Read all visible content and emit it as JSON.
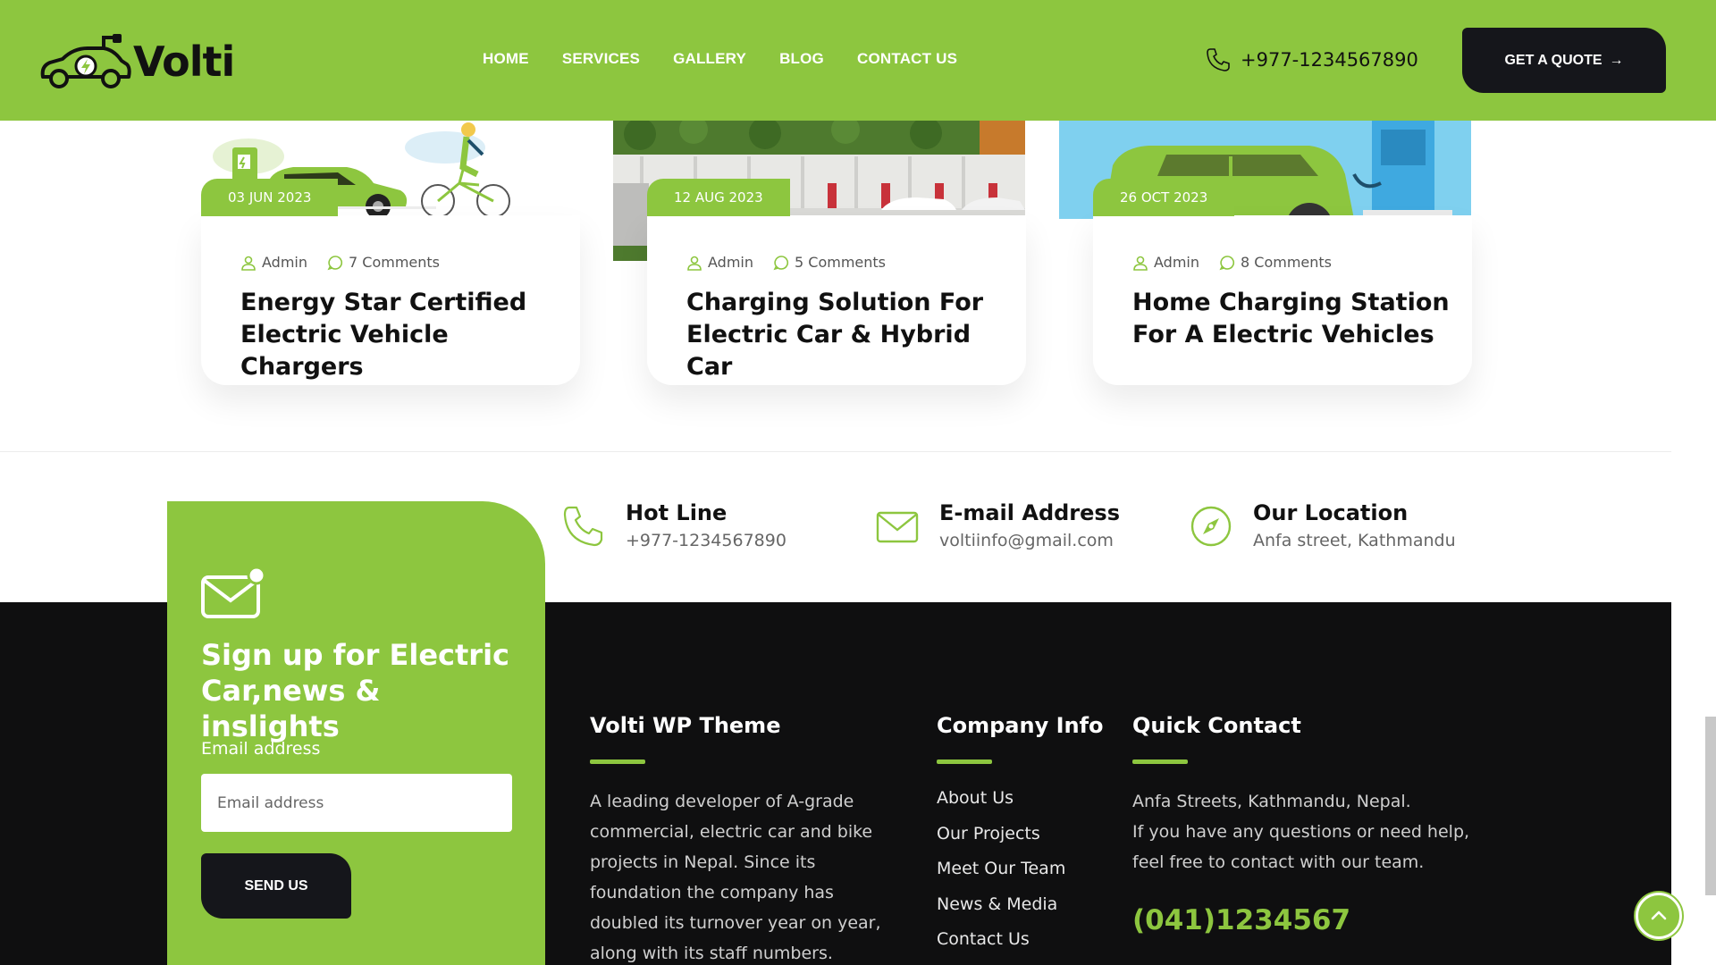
{
  "header": {
    "logo_text": "Volti",
    "nav": [
      "HOME",
      "SERVICES",
      "GALLERY",
      "BLOG",
      "CONTACT US"
    ],
    "phone": "+977-1234567890",
    "quote_button": "GET A QUOTE",
    "brand_color": "#8dc63f"
  },
  "blog": {
    "cards": [
      {
        "date": "03 JUN 2023",
        "author": "Admin",
        "comments": "7 Comments",
        "title": "Energy Star Certified Electric Vehicle Chargers"
      },
      {
        "date": "12 AUG 2023",
        "author": "Admin",
        "comments": "5 Comments",
        "title": "Charging Solution For Electric Car & Hybrid Car"
      },
      {
        "date": "26 OCT 2023",
        "author": "Admin",
        "comments": "8 Comments",
        "title": "Home Charging Station For A Electric Vehicles"
      }
    ]
  },
  "contact_strip": {
    "hotline": {
      "title": "Hot Line",
      "value": "+977-1234567890",
      "icon": "phone-icon"
    },
    "email": {
      "title": "E-mail Address",
      "value": "voltiinfo@gmail.com",
      "icon": "mail-icon"
    },
    "location": {
      "title": "Our Location",
      "value": "Anfa street, Kathmandu",
      "icon": "compass-icon"
    }
  },
  "signup": {
    "title": "Sign up for Electric Car,news & inslights",
    "label": "Email address",
    "placeholder": "Email address",
    "button": "SEND US"
  },
  "footer": {
    "about": {
      "title": "Volti WP Theme",
      "text": "A leading developer of A-grade commercial, electric car and bike projects in Nepal. Since its foundation the company has doubled its turnover year on year, along with its staff numbers."
    },
    "company": {
      "title": "Company Info",
      "links": [
        "About Us",
        "Our Projects",
        "Meet Our Team",
        "News & Media",
        "Contact Us"
      ]
    },
    "quick_contact": {
      "title": "Quick Contact",
      "address": "Anfa Streets, Kathmandu, Nepal.",
      "text": "If you have any questions or need help, feel free to contact with our team.",
      "phone": "(041)1234567"
    }
  }
}
